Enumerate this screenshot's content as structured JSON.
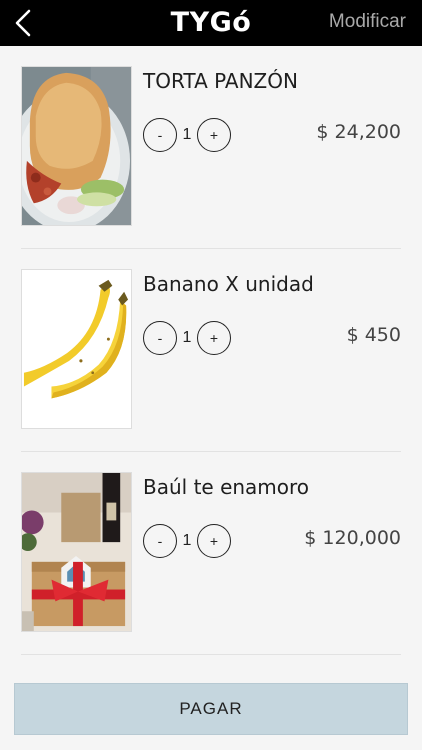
{
  "header": {
    "brand": "TYGó",
    "modify_label": "Modificar"
  },
  "items": [
    {
      "name": "TORTA PANZÓN",
      "quantity": "1",
      "price": "$ 24,200",
      "decrement": "-",
      "increment": "+"
    },
    {
      "name": "Banano X unidad",
      "quantity": "1",
      "price": "$ 450",
      "decrement": "-",
      "increment": "+"
    },
    {
      "name": "Baúl te enamoro",
      "quantity": "1",
      "price": "$ 120,000",
      "decrement": "-",
      "increment": "+"
    }
  ],
  "footer": {
    "pay_label": "PAGAR"
  },
  "colors": {
    "header_bg": "#000000",
    "pay_button_bg": "#c5d6de",
    "page_bg": "#f5f5f5"
  }
}
